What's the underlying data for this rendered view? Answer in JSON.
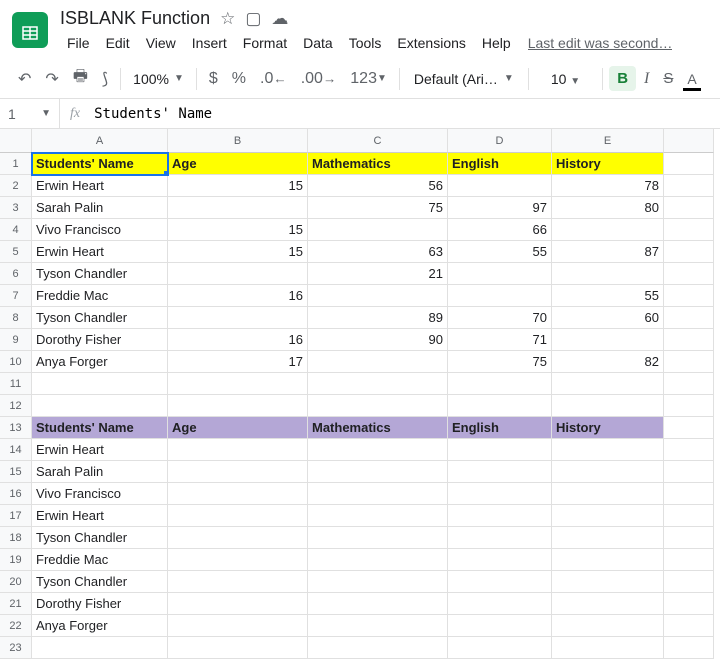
{
  "doc": {
    "title": "ISBLANK Function",
    "last_edit": "Last edit was second…"
  },
  "menu": {
    "file": "File",
    "edit": "Edit",
    "view": "View",
    "insert": "Insert",
    "format": "Format",
    "data": "Data",
    "tools": "Tools",
    "extensions": "Extensions",
    "help": "Help"
  },
  "toolbar": {
    "zoom": "100%",
    "dollar": "$",
    "percent": "%",
    "dec_dec": ".0",
    "inc_dec": ".00",
    "numfmt": "123",
    "font": "Default (Ari…",
    "fontsize": "10",
    "bold": "B",
    "italic": "I",
    "strike": "S",
    "textcolor": "A"
  },
  "formula": {
    "cellref": "1",
    "value": "Students' Name"
  },
  "cols": [
    "A",
    "B",
    "C",
    "D",
    "E",
    ""
  ],
  "rows": [
    "1",
    "2",
    "3",
    "4",
    "5",
    "6",
    "7",
    "8",
    "9",
    "10",
    "11",
    "12",
    "13",
    "14",
    "15",
    "16",
    "17",
    "18",
    "19",
    "20",
    "21",
    "22",
    "23"
  ],
  "chart_data": {
    "type": "table",
    "tables": [
      {
        "header_row": 1,
        "header_style": "yellow",
        "columns": [
          "Students' Name",
          "Age",
          "Mathematics",
          "English",
          "History"
        ],
        "rows": [
          {
            "r": 2,
            "name": "Erwin Heart",
            "age": 15,
            "math": 56,
            "eng": null,
            "hist": 78
          },
          {
            "r": 3,
            "name": "Sarah Palin",
            "age": null,
            "math": 75,
            "eng": 97,
            "hist": 80
          },
          {
            "r": 4,
            "name": "Vivo Francisco",
            "age": 15,
            "math": null,
            "eng": 66,
            "hist": null
          },
          {
            "r": 5,
            "name": "Erwin Heart",
            "age": 15,
            "math": 63,
            "eng": 55,
            "hist": 87
          },
          {
            "r": 6,
            "name": "Tyson Chandler",
            "age": null,
            "math": 21,
            "eng": null,
            "hist": null
          },
          {
            "r": 7,
            "name": "Freddie Mac",
            "age": 16,
            "math": null,
            "eng": null,
            "hist": 55
          },
          {
            "r": 8,
            "name": "Tyson Chandler",
            "age": null,
            "math": 89,
            "eng": 70,
            "hist": 60
          },
          {
            "r": 9,
            "name": "Dorothy Fisher",
            "age": 16,
            "math": 90,
            "eng": 71,
            "hist": null
          },
          {
            "r": 10,
            "name": "Anya Forger",
            "age": 17,
            "math": null,
            "eng": 75,
            "hist": 82
          }
        ]
      },
      {
        "header_row": 13,
        "header_style": "purple",
        "columns": [
          "Students' Name",
          "Age",
          "Mathematics",
          "English",
          "History"
        ],
        "rows": [
          {
            "r": 14,
            "name": "Erwin Heart",
            "age": null,
            "math": null,
            "eng": null,
            "hist": null
          },
          {
            "r": 15,
            "name": "Sarah Palin",
            "age": null,
            "math": null,
            "eng": null,
            "hist": null
          },
          {
            "r": 16,
            "name": "Vivo Francisco",
            "age": null,
            "math": null,
            "eng": null,
            "hist": null
          },
          {
            "r": 17,
            "name": "Erwin Heart",
            "age": null,
            "math": null,
            "eng": null,
            "hist": null
          },
          {
            "r": 18,
            "name": "Tyson Chandler",
            "age": null,
            "math": null,
            "eng": null,
            "hist": null
          },
          {
            "r": 19,
            "name": "Freddie Mac",
            "age": null,
            "math": null,
            "eng": null,
            "hist": null
          },
          {
            "r": 20,
            "name": "Tyson Chandler",
            "age": null,
            "math": null,
            "eng": null,
            "hist": null
          },
          {
            "r": 21,
            "name": "Dorothy Fisher",
            "age": null,
            "math": null,
            "eng": null,
            "hist": null
          },
          {
            "r": 22,
            "name": "Anya Forger",
            "age": null,
            "math": null,
            "eng": null,
            "hist": null
          }
        ]
      }
    ]
  }
}
